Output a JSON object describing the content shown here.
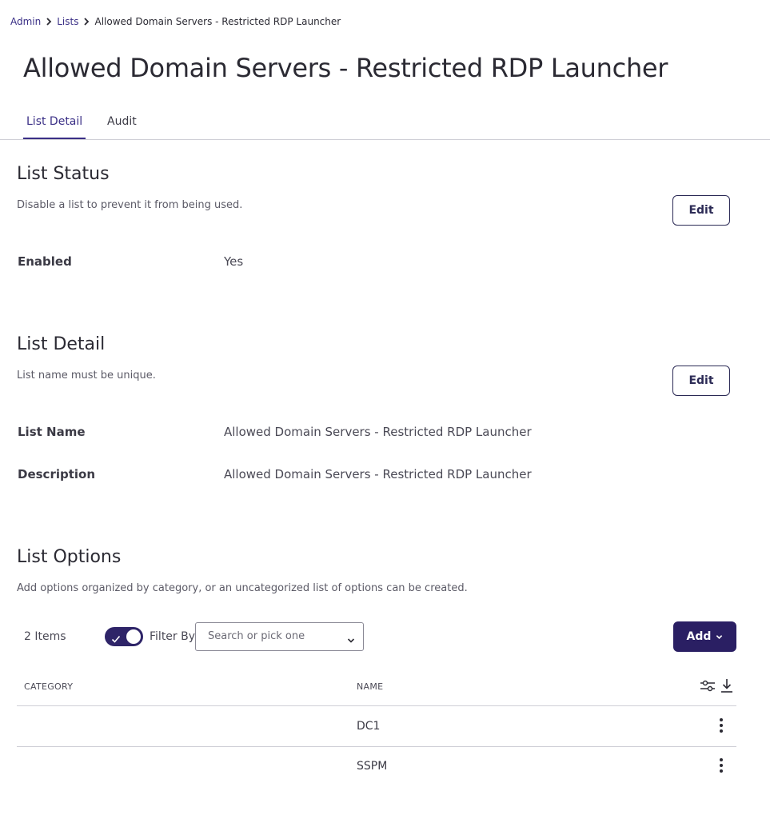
{
  "breadcrumb": {
    "items": [
      "Admin",
      "Lists"
    ],
    "current": "Allowed Domain Servers - Restricted RDP Launcher"
  },
  "page": {
    "title": "Allowed Domain Servers - Restricted RDP Launcher"
  },
  "tabs": [
    {
      "label": "List Detail",
      "active": true
    },
    {
      "label": "Audit",
      "active": false
    }
  ],
  "list_status": {
    "title": "List Status",
    "description": "Disable a list to prevent it from being used.",
    "edit_label": "Edit",
    "fields": [
      {
        "label": "Enabled",
        "value": "Yes"
      }
    ]
  },
  "list_detail": {
    "title": "List Detail",
    "description": "List name must be unique.",
    "edit_label": "Edit",
    "fields": [
      {
        "label": "List Name",
        "value": "Allowed Domain Servers - Restricted RDP Launcher"
      },
      {
        "label": "Description",
        "value": "Allowed Domain Servers - Restricted RDP Launcher"
      }
    ]
  },
  "list_options": {
    "title": "List Options",
    "description": "Add options organized by category, or an uncategorized list of options can be created.",
    "items_count": "2 Items",
    "filter_toggle_on": true,
    "filter_label": "Filter By",
    "filter_placeholder": "Search or pick one",
    "add_label": "Add",
    "columns": [
      "CATEGORY",
      "NAME"
    ],
    "rows": [
      {
        "category": "",
        "name": "DC1"
      },
      {
        "category": "",
        "name": "SSPM"
      }
    ]
  },
  "colors": {
    "accent": "#3a2f86",
    "primary_button": "#2a1f63",
    "toggle": "#2e2468",
    "divider": "#cfcfd6"
  },
  "icons": [
    "chevron-right-icon",
    "check-icon",
    "chevron-down-icon",
    "column-settings-icon",
    "download-icon",
    "more-vertical-icon"
  ]
}
